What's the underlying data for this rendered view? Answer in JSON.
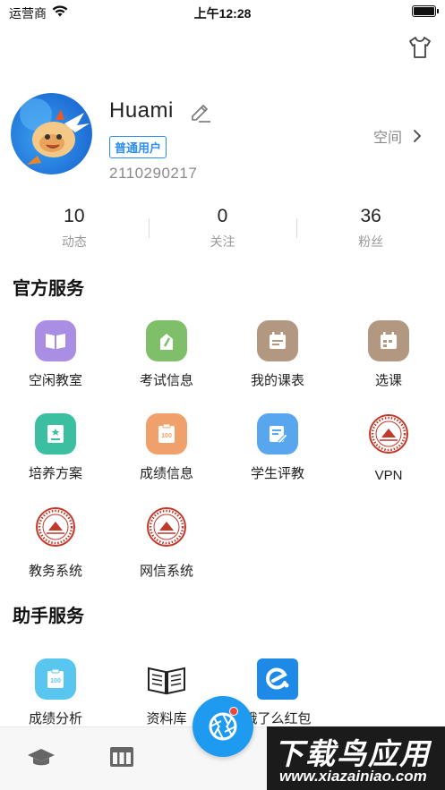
{
  "status_bar": {
    "carrier": "运营商",
    "time": "上午12:28"
  },
  "profile": {
    "username": "Huami",
    "badge": "普通用户",
    "user_id": "2110290217",
    "space_label": "空间"
  },
  "stats": [
    {
      "value": "10",
      "label": "动态"
    },
    {
      "value": "0",
      "label": "关注"
    },
    {
      "value": "36",
      "label": "粉丝"
    }
  ],
  "official_services": {
    "title": "官方服务",
    "items": [
      {
        "label": "空闲教室",
        "icon": "book-icon",
        "color": "#a98ee4"
      },
      {
        "label": "考试信息",
        "icon": "pencil-paper-icon",
        "color": "#7fbf6a"
      },
      {
        "label": "我的课表",
        "icon": "calendar-icon",
        "color": "#b29880"
      },
      {
        "label": "选课",
        "icon": "calendar-select-icon",
        "color": "#b29880"
      },
      {
        "label": "培养方案",
        "icon": "plan-icon",
        "color": "#3bbfa0"
      },
      {
        "label": "成绩信息",
        "icon": "score-icon",
        "color": "#f0a06a"
      },
      {
        "label": "学生评教",
        "icon": "evaluate-icon",
        "color": "#58a6ee"
      },
      {
        "label": "VPN",
        "icon": "university-seal-icon",
        "color": "#c0392b"
      },
      {
        "label": "教务系统",
        "icon": "university-seal-icon",
        "color": "#c0392b"
      },
      {
        "label": "网信系统",
        "icon": "university-seal-icon",
        "color": "#c0392b"
      }
    ]
  },
  "assistant_services": {
    "title": "助手服务",
    "items": [
      {
        "label": "成绩分析",
        "icon": "score-analysis-icon",
        "color": "#58c6ee"
      },
      {
        "label": "资料库",
        "icon": "open-book-icon",
        "color": "#333333"
      },
      {
        "label": "饿了么红包",
        "icon": "eleme-icon",
        "color": "#1e8ae8"
      }
    ]
  },
  "watermark": {
    "line1": "下载鸟应用",
    "line2": "www.xiazainiao.com"
  },
  "colors": {
    "accent": "#1e9af0",
    "badge": "#2c8ef0"
  }
}
